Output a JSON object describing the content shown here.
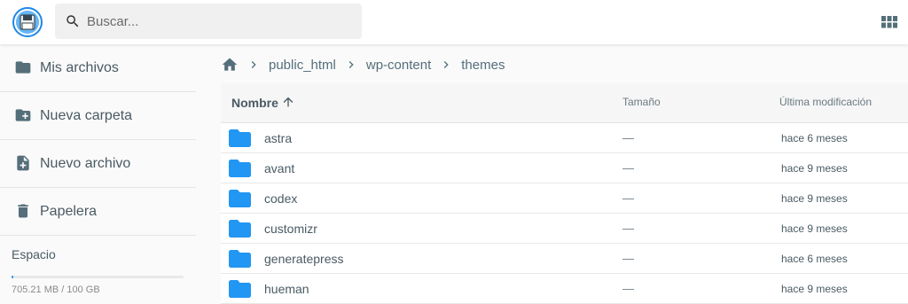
{
  "header": {
    "search_placeholder": "Buscar..."
  },
  "sidebar": {
    "items": [
      {
        "label": "Mis archivos",
        "icon": "folder-icon"
      },
      {
        "label": "Nueva carpeta",
        "icon": "create-folder-icon"
      },
      {
        "label": "Nuevo archivo",
        "icon": "new-file-icon"
      },
      {
        "label": "Papelera",
        "icon": "trash-icon"
      }
    ],
    "storage": {
      "title": "Espacio",
      "usage": "705.21 MB / 100 GB",
      "used_fraction": 0.007
    }
  },
  "breadcrumb": [
    "public_html",
    "wp-content",
    "themes"
  ],
  "table": {
    "headers": {
      "name": "Nombre",
      "size": "Tamaño",
      "modified": "Última modificación"
    },
    "rows": [
      {
        "name": "astra",
        "size": "—",
        "modified": "hace 6 meses"
      },
      {
        "name": "avant",
        "size": "—",
        "modified": "hace 9 meses"
      },
      {
        "name": "codex",
        "size": "—",
        "modified": "hace 9 meses"
      },
      {
        "name": "customizr",
        "size": "—",
        "modified": "hace 9 meses"
      },
      {
        "name": "generatepress",
        "size": "—",
        "modified": "hace 6 meses"
      },
      {
        "name": "hueman",
        "size": "—",
        "modified": "hace 9 meses"
      }
    ]
  },
  "colors": {
    "accent": "#2196f3",
    "text": "#546e7a",
    "folder": "#2196f3"
  }
}
